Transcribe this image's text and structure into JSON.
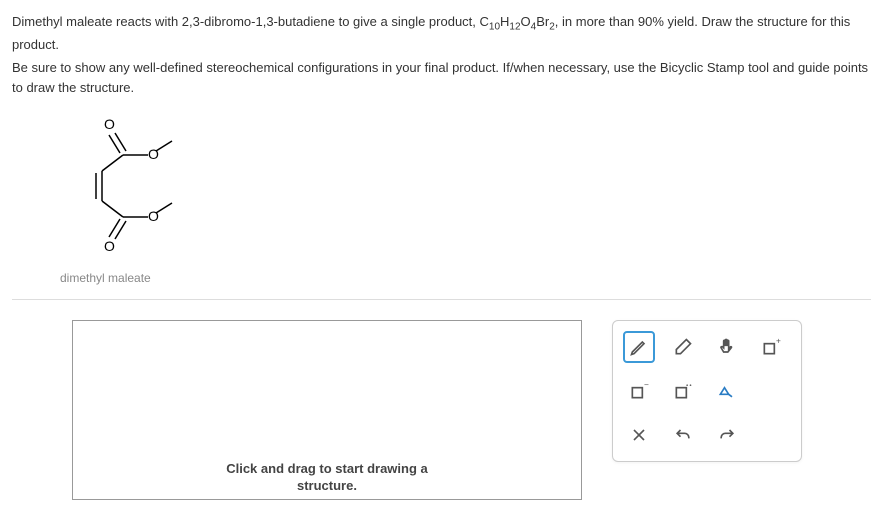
{
  "question": {
    "line1_part1": "Dimethyl maleate reacts with 2,3-dibromo-1,3-butadiene to give a single product, C",
    "formula_sub1": "10",
    "formula_mid1": "H",
    "formula_sub2": "12",
    "formula_mid2": "O",
    "formula_sub3": "4",
    "formula_mid3": "Br",
    "formula_sub4": "2",
    "line1_part2": ", in more than 90% yield. Draw the structure for this product.",
    "line2": "Be sure to show any well-defined stereochemical configurations in your final product. If/when necessary, use the Bicyclic Stamp tool and guide points to draw the structure."
  },
  "molecule": {
    "label": "dimethyl maleate",
    "atoms": {
      "o1": "O",
      "o2": "O",
      "o3": "O",
      "o4": "O"
    }
  },
  "canvas": {
    "message_line1": "Click and drag to start drawing a",
    "message_line2": "structure."
  }
}
